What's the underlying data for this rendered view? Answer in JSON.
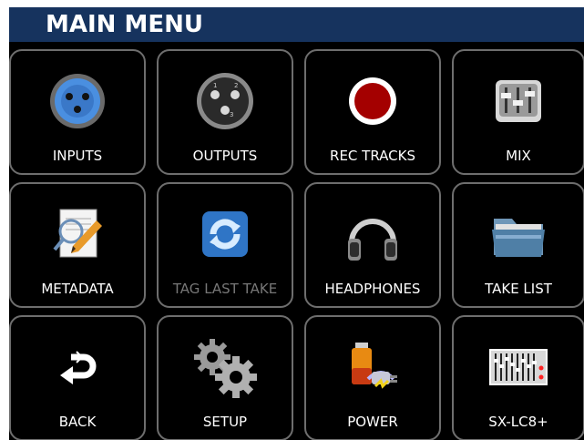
{
  "screen": {
    "title": "MAIN MENU"
  },
  "menu": {
    "tiles": [
      {
        "label": "INPUTS",
        "icon": "xlr-female-icon"
      },
      {
        "label": "OUTPUTS",
        "icon": "xlr-male-icon"
      },
      {
        "label": "REC TRACKS",
        "icon": "record-icon"
      },
      {
        "label": "MIX",
        "icon": "mixer-faders-icon"
      },
      {
        "label": "METADATA",
        "icon": "metadata-pencil-icon"
      },
      {
        "label": "TAG LAST TAKE",
        "icon": "refresh-arrows-icon",
        "enabled": false
      },
      {
        "label": "HEADPHONES",
        "icon": "headphones-icon"
      },
      {
        "label": "TAKE LIST",
        "icon": "folder-icon"
      },
      {
        "label": "BACK",
        "icon": "back-arrow-icon"
      },
      {
        "label": "SETUP",
        "icon": "gears-icon"
      },
      {
        "label": "POWER",
        "icon": "battery-plug-icon"
      },
      {
        "label": "SX-LC8+",
        "icon": "control-surface-icon"
      }
    ]
  },
  "colors": {
    "titlebar": "#16335e",
    "tile_border": "#6e6e6e",
    "record_red": "#a40000",
    "xlr_blue": "#4a8fe0",
    "disabled_text": "#777777"
  }
}
